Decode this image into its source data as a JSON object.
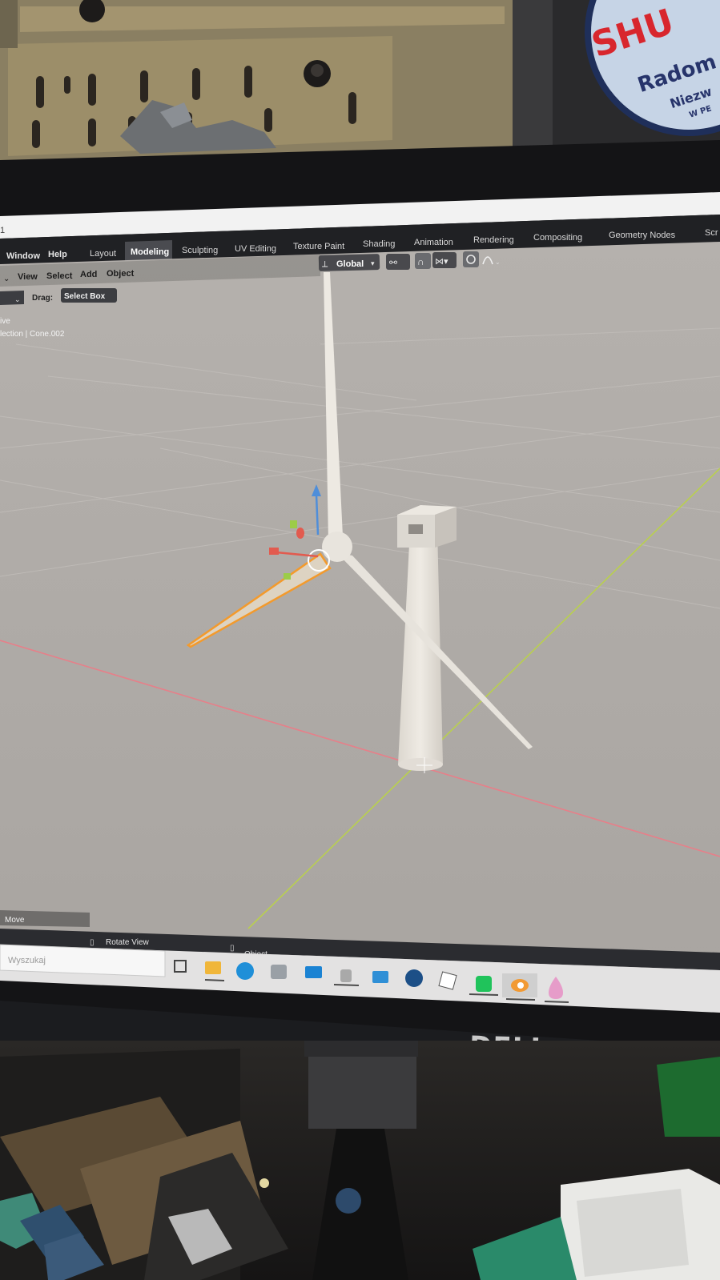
{
  "badge": {
    "line1": "SHU",
    "line2": "Radom",
    "line3": "Niezw",
    "line4": "W PE"
  },
  "blender": {
    "window_title_fragment": "1",
    "menus": [
      "Window",
      "Help"
    ],
    "workspace_tabs": [
      "Layout",
      "Modeling",
      "Sculpting",
      "UV Editing",
      "Texture Paint",
      "Shading",
      "Animation",
      "Rendering",
      "Compositing",
      "Geometry Nodes",
      "Scr"
    ],
    "active_tab": "Modeling",
    "header_menus": [
      "View",
      "Select",
      "Add",
      "Object"
    ],
    "transform_orientation": "Global",
    "drag_label": "Drag:",
    "drag_value": "Select Box",
    "viewport_overlay_line1": "ive",
    "viewport_overlay_line2": "lection | Cone.002",
    "last_operator": "Move",
    "status_rotate": "Rotate View",
    "status_object": "Object",
    "search_placeholder": "Wyszukaj"
  },
  "monitor": {
    "brand": "DELL"
  },
  "colors": {
    "viewport_bg": "#aeaaa6",
    "x_axis": "#e77f89",
    "y_axis": "#b9d04e",
    "selection": "#f39a2c",
    "header_bg": "#26272b",
    "taskbar_bg": "#e3e2e2"
  }
}
